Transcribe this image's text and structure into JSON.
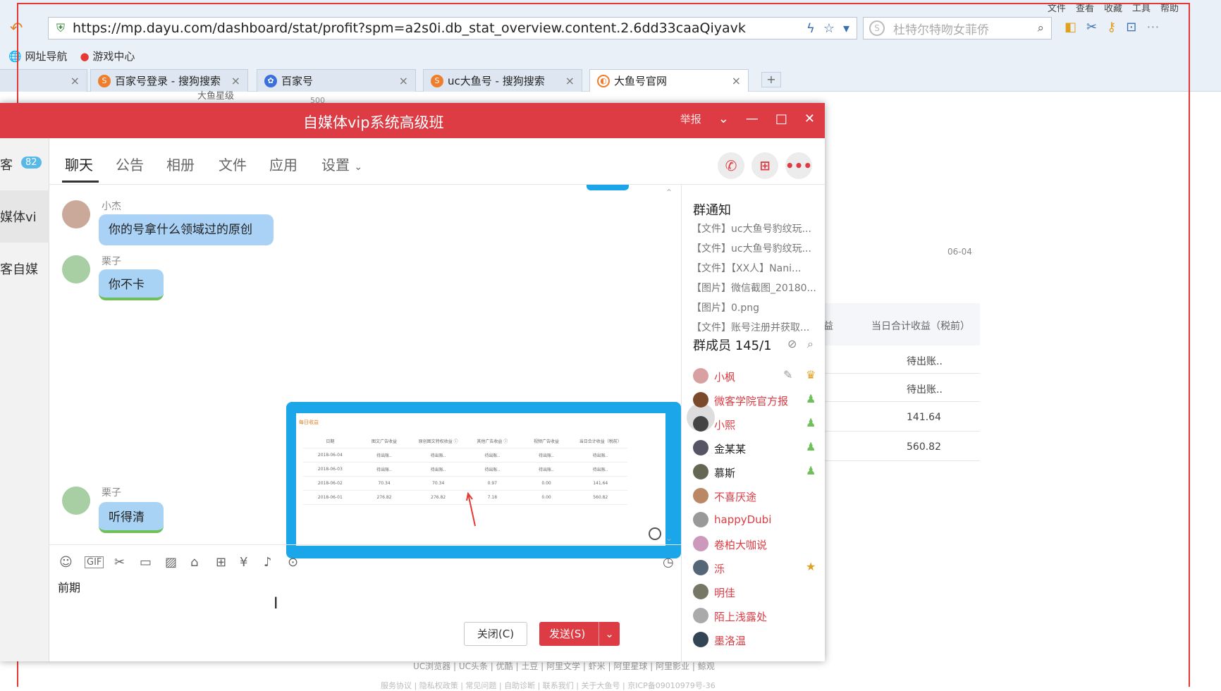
{
  "browser": {
    "menu": [
      "文件",
      "查看",
      "收藏",
      "工具",
      "帮助"
    ],
    "url": "https://mp.dayu.com/dashboard/stat/profit?spm=a2s0i.db_stat_overview.content.2.6dd33caaQiyavk",
    "search_placeholder": "杜特尔特吻女菲侨",
    "bookmarks": [
      "网址导航",
      "游戏中心"
    ],
    "tabs": [
      {
        "label": "百家号登录 - 搜狗搜索",
        "icon": "sogou-icon"
      },
      {
        "label": "百家号",
        "icon": "paw-icon"
      },
      {
        "label": "uc大鱼号 - 搜狗搜索",
        "icon": "sogou-icon"
      },
      {
        "label": "大鱼号官网",
        "icon": "dayu-icon"
      }
    ],
    "new_tab": "+"
  },
  "background_page": {
    "chart_title": "大鱼星级",
    "chart_tick": "500",
    "date_label": "06-04",
    "table_header": [
      "益",
      "当日合计收益（税前）"
    ],
    "table_values": [
      "待出账..",
      "待出账..",
      "141.64",
      "560.82"
    ],
    "footer_links": "UC浏览器 | UC头条 | 优酷 | 土豆 | 阿里文学 | 虾米 | 阿里星球 | 阿里影业 | 鲸观",
    "footer_sub": "服务协议 | 隐私权政策 | 常见问题 | 自助诊断 | 联系我们 | 关于大鱼号 | 京ICP备09010979号-36"
  },
  "qq": {
    "title": "自媒体vip系统高级班",
    "report": "举报",
    "left_badge": "82",
    "left_items": [
      "客",
      "媒体vi",
      "客自媒"
    ],
    "tabs": [
      "聊天",
      "公告",
      "相册",
      "文件",
      "应用",
      "设置"
    ],
    "messages": [
      {
        "sender": "小杰",
        "text": "你的号拿什么领域过的原创"
      },
      {
        "sender": "栗子",
        "text": "你不卡"
      },
      {
        "sender": "栗子",
        "text": "听得清"
      }
    ],
    "image_table": {
      "caption": "每日收益",
      "headers": [
        "日期",
        "图文广告收益",
        "原创图文特权收益 ⓘ",
        "其他广告收益 ⓘ",
        "视频广告收益",
        "当日合计收益（税前）"
      ],
      "rows": [
        [
          "2018-06-04",
          "待出账..",
          "待出账..",
          "待出账..",
          "待出账..",
          "待出账.."
        ],
        [
          "2018-06-03",
          "待出账..",
          "待出账..",
          "待出账..",
          "待出账..",
          "待出账.."
        ],
        [
          "2018-06-02",
          "70.34",
          "70.34",
          "0.97",
          "0.00",
          "141.64"
        ],
        [
          "2018-06-01",
          "276.82",
          "276.82",
          "7.18",
          "0.00",
          "560.82"
        ]
      ]
    },
    "notice_title": "群通知",
    "notices": [
      "【文件】uc大鱼号豹纹玩...",
      "【文件】uc大鱼号豹纹玩...",
      "【文件】【XX人】Nani...",
      "【图片】微信截图_20180...",
      "【图片】0.png",
      "【文件】账号注册并获取..."
    ],
    "members_title": "群成员 145/1",
    "members": [
      "小枫",
      "微客学院官方报",
      "小熙",
      "金某某",
      "慕斯",
      "不喜厌途",
      "happyDubi",
      "卷柏大咖说",
      "泺",
      "明佳",
      "陌上浅露处",
      "墨洛温"
    ],
    "input_text": "前期",
    "close_button": "关闭(C)",
    "send_button": "发送(S)",
    "colors": {
      "titlebar": "#dd3c44",
      "bubble": "#aad2f6",
      "image_border": "#1aa6e9"
    }
  }
}
